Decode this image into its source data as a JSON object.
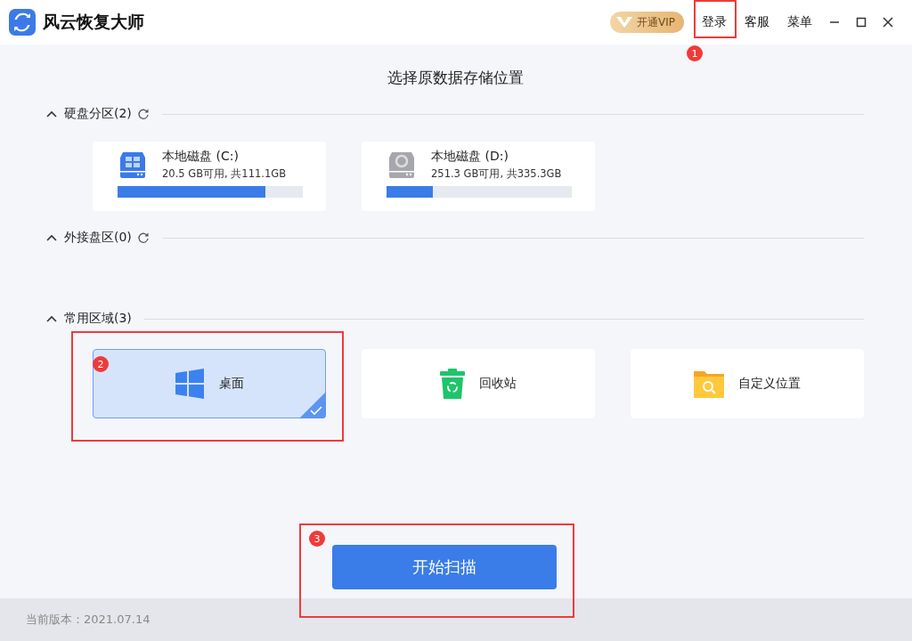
{
  "app": {
    "title": "风云恢复大师",
    "vip_button": "开通VIP",
    "menu": [
      {
        "label": "登录",
        "annotation": "1"
      },
      {
        "label": "客服"
      },
      {
        "label": "菜单"
      }
    ]
  },
  "heading": "选择原数据存储位置",
  "sections": [
    {
      "title": "硬盘分区(2)",
      "kind": "disks",
      "expanded": true,
      "refresh": true,
      "items": [
        {
          "name": "本地磁盘 (C:)",
          "info": "20.5 GB可用, 共111.1GB",
          "kind": "system",
          "level": 0.8
        },
        {
          "name": "本地磁盘 (D:)",
          "info": "251.3 GB可用, 共335.3GB",
          "kind": "data",
          "level": 0.25
        }
      ]
    },
    {
      "title": "外接盘区(0)",
      "kind": "disks",
      "expanded": true,
      "refresh": true
    },
    {
      "title": "常用区域(3)",
      "kind": "locations",
      "expanded": true,
      "refresh": false,
      "items": [
        {
          "label": "桌面",
          "kind": "desktop",
          "selected": true,
          "annotation": "2"
        },
        {
          "label": "回收站",
          "kind": "recycle",
          "selected": false
        },
        {
          "label": "自定义位置",
          "kind": "folder",
          "selected": false
        }
      ]
    }
  ],
  "scan_button": {
    "label": "开始扫描",
    "annotation": "3"
  },
  "version": "当前版本：2021.07.14"
}
